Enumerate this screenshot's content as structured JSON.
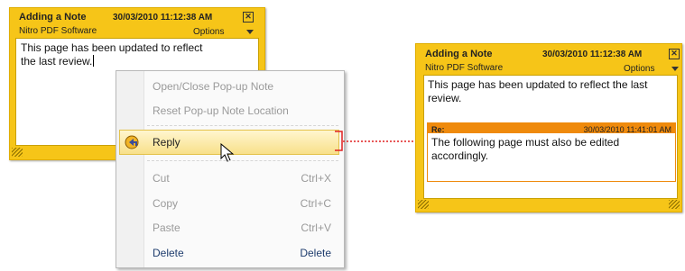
{
  "note_left": {
    "title": "Adding a Note",
    "date": "30/03/2010 11:12:38 AM",
    "author": "Nitro PDF Software",
    "options_label": "Options",
    "close_symbol": "✕",
    "body_lines": [
      "This page has been updated to reflect",
      "the last review."
    ]
  },
  "menu": {
    "items": [
      {
        "label": "Open/Close Pop-up Note",
        "shortcut": "",
        "enabled": false
      },
      {
        "label": "Reset Pop-up Note Location",
        "shortcut": "",
        "enabled": false
      },
      {
        "label": "Reply",
        "shortcut": "",
        "enabled": true,
        "highlighted": true,
        "icon": "reply-icon"
      },
      {
        "label": "Cut",
        "shortcut": "Ctrl+X",
        "enabled": false
      },
      {
        "label": "Copy",
        "shortcut": "Ctrl+C",
        "enabled": false
      },
      {
        "label": "Paste",
        "shortcut": "Ctrl+V",
        "enabled": false
      },
      {
        "label": "Delete",
        "shortcut": "Delete",
        "enabled": true
      }
    ]
  },
  "note_right": {
    "title": "Adding a Note",
    "date": "30/03/2010 11:12:38 AM",
    "author": "Nitro PDF Software",
    "options_label": "Options",
    "close_symbol": "✕",
    "body_lines": [
      "This page has been updated to reflect the last",
      "review."
    ],
    "reply": {
      "label": "Re:",
      "date": "30/03/2010 11:41:01 AM",
      "body_lines": [
        "The following page must also be edited",
        "accordingly."
      ]
    }
  },
  "colors": {
    "note_yellow": "#f6c518",
    "reply_orange": "#ef8a0c",
    "connector_red": "#e02020"
  }
}
